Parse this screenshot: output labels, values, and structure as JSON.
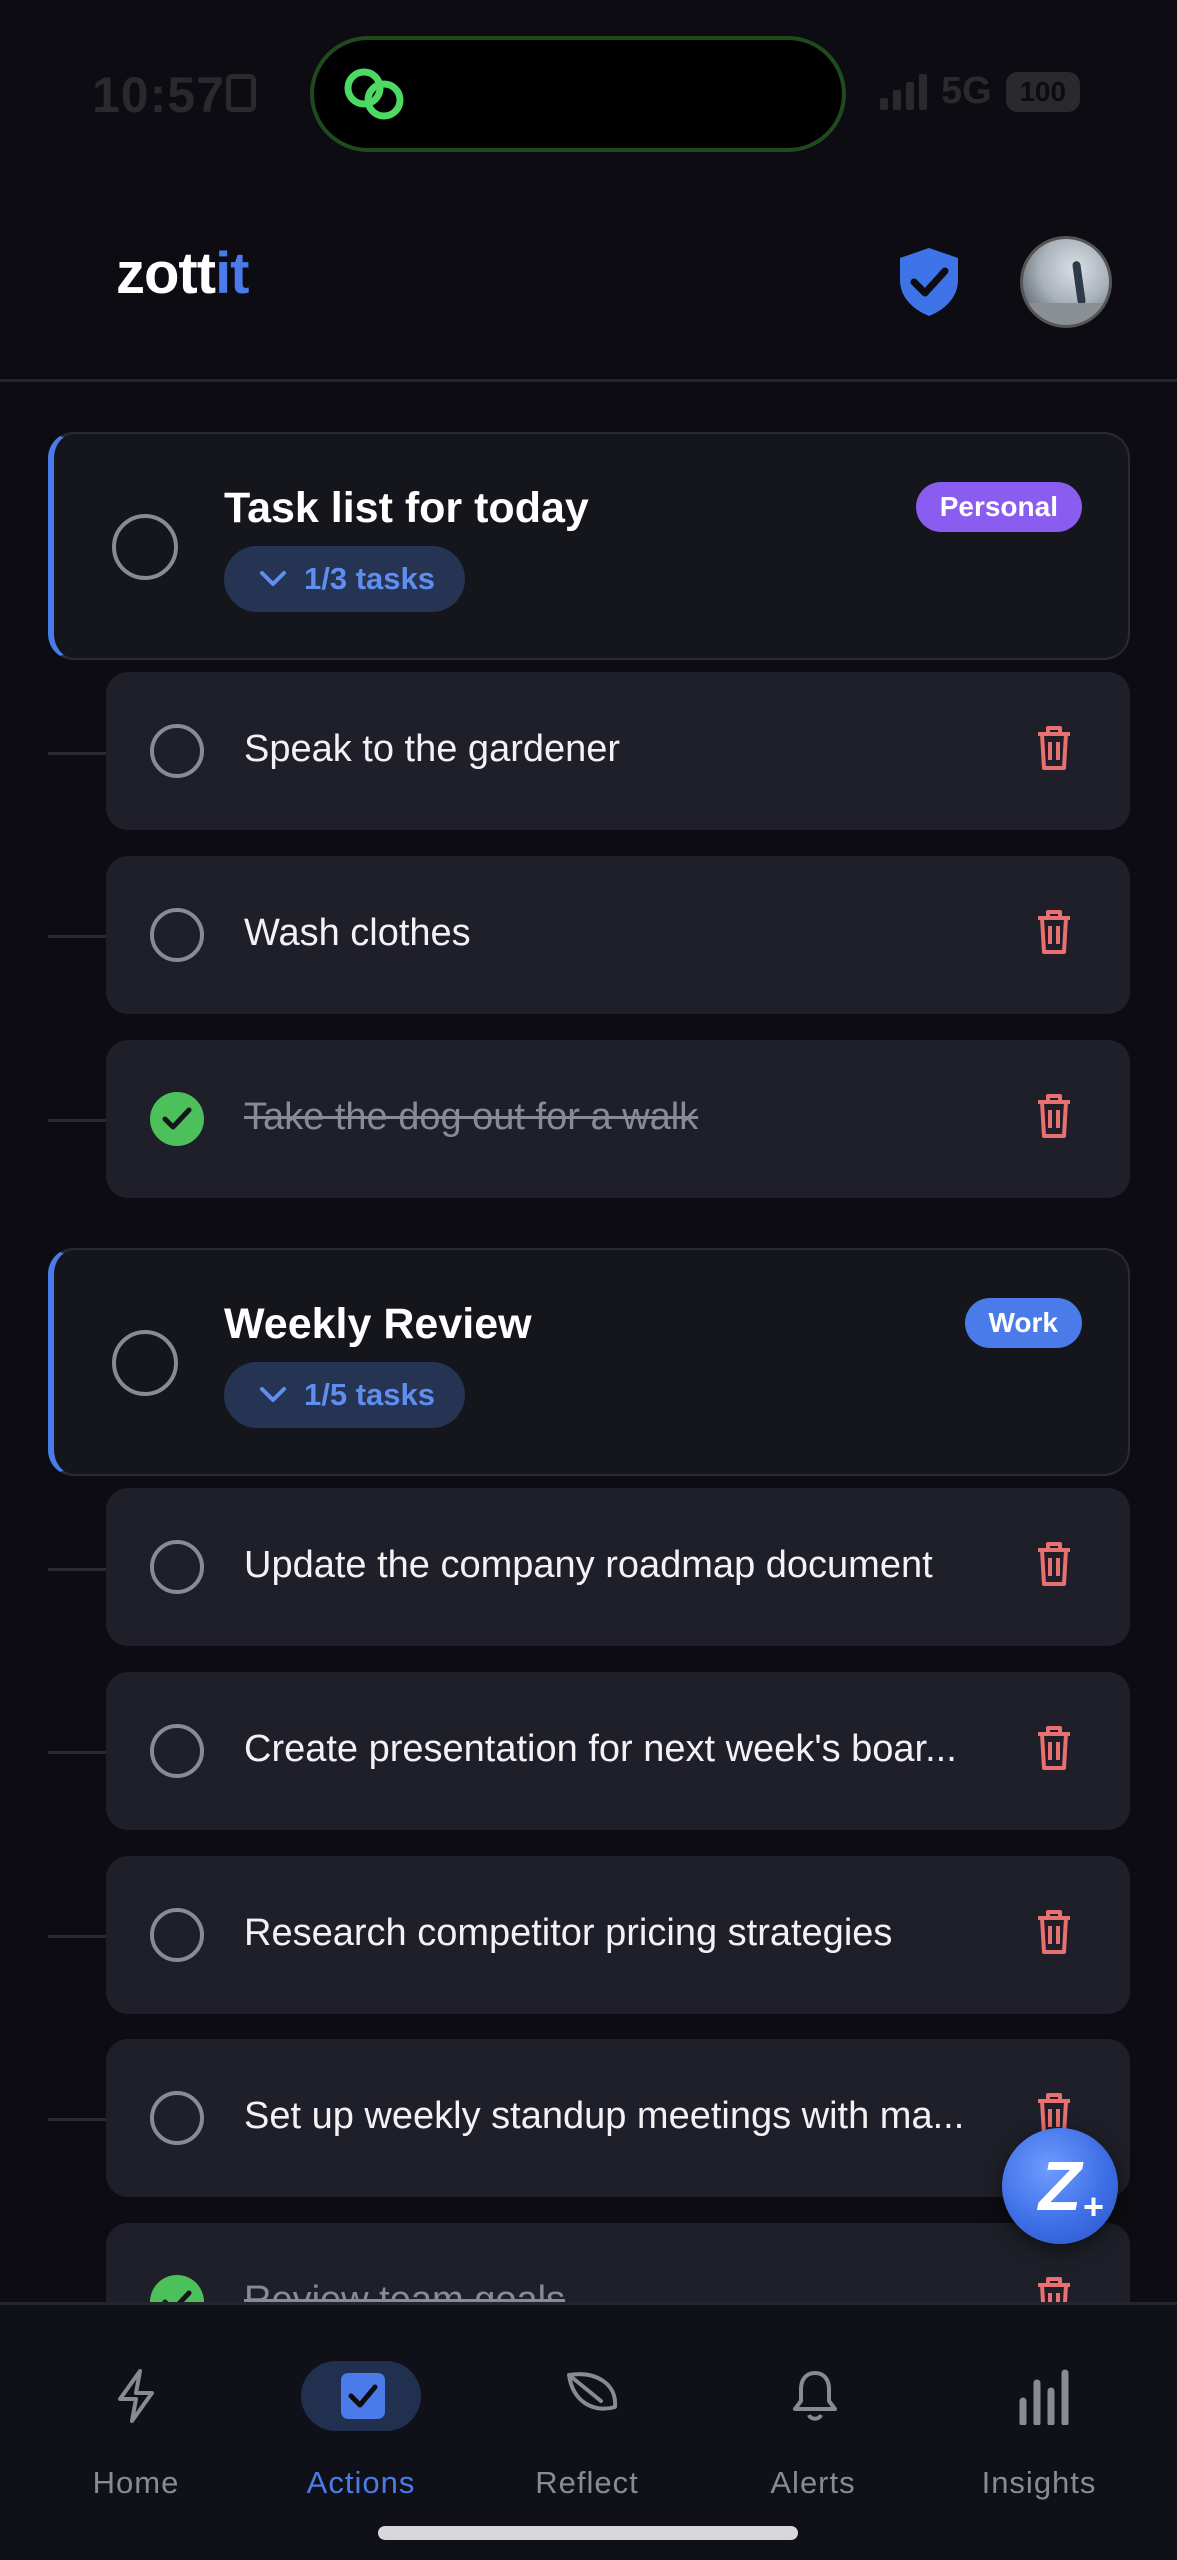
{
  "status_bar": {
    "time": "10:57",
    "network": "5G",
    "battery": "100"
  },
  "header": {
    "logo_main": "zott",
    "logo_accent": "it"
  },
  "groups": [
    {
      "title": "Task list for today",
      "count": "1/3 tasks",
      "badge": "Personal",
      "tasks": [
        {
          "text": "Speak to the gardener",
          "done": false
        },
        {
          "text": "Wash clothes",
          "done": false
        },
        {
          "text": "Take the dog out for a walk",
          "done": true
        }
      ]
    },
    {
      "title": "Weekly Review",
      "count": "1/5 tasks",
      "badge": "Work",
      "tasks": [
        {
          "text": "Update the company roadmap document",
          "done": false
        },
        {
          "text": "Create presentation for next week's boar...",
          "done": false
        },
        {
          "text": "Research competitor pricing strategies",
          "done": false
        },
        {
          "text": "Set up weekly standup meetings with ma...",
          "done": false
        },
        {
          "text": "Review team goals",
          "done": true
        }
      ]
    }
  ],
  "fab": {
    "label": "Z"
  },
  "nav": {
    "items": [
      {
        "label": "Home",
        "icon": "lightning-icon",
        "active": false
      },
      {
        "label": "Actions",
        "icon": "checkbox-icon",
        "active": true
      },
      {
        "label": "Reflect",
        "icon": "leaf-icon",
        "active": false
      },
      {
        "label": "Alerts",
        "icon": "bell-icon",
        "active": false
      },
      {
        "label": "Insights",
        "icon": "bar-chart-icon",
        "active": false
      }
    ]
  },
  "colors": {
    "accent": "#4a7be8",
    "personal_badge": "#8a5cf0",
    "work_badge": "#4a7be8",
    "done_check": "#4cc05a",
    "trash": "#e87070"
  }
}
